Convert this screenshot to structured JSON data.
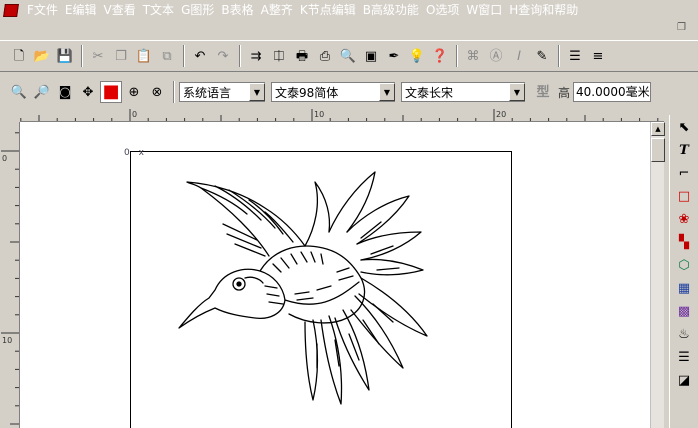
{
  "menu": {
    "items": [
      "F文件",
      "E编辑",
      "V查看",
      "T文本",
      "G图形",
      "B表格",
      "A整齐",
      "K节点编辑",
      "B高级功能",
      "O选项",
      "W窗口",
      "H查询和帮助"
    ]
  },
  "toolbar1": {
    "buttons": [
      {
        "name": "new-file-button",
        "icon": "new-file-icon",
        "glyph": "🗋"
      },
      {
        "name": "open-file-button",
        "icon": "open-folder-icon",
        "glyph": "📂"
      },
      {
        "name": "save-button",
        "icon": "floppy-icon",
        "glyph": "💾"
      },
      {
        "sep": true
      },
      {
        "name": "cut-button",
        "icon": "scissors-icon",
        "glyph": "✂",
        "dis": true
      },
      {
        "name": "copy-button",
        "icon": "copy-icon",
        "glyph": "❐",
        "dis": true
      },
      {
        "name": "paste-button",
        "icon": "paste-icon",
        "glyph": "📋",
        "dis": true
      },
      {
        "name": "paste-special-button",
        "icon": "paste-special-icon",
        "glyph": "⧉",
        "dis": true
      },
      {
        "sep": true
      },
      {
        "name": "undo-button",
        "icon": "undo-icon",
        "glyph": "↶"
      },
      {
        "name": "redo-button",
        "icon": "redo-icon",
        "glyph": "↷",
        "dis": true
      },
      {
        "sep": true
      },
      {
        "name": "import-button",
        "icon": "import-icon",
        "glyph": "⇉"
      },
      {
        "name": "text-frame-button",
        "icon": "text-frame-icon",
        "glyph": "⎅"
      },
      {
        "name": "print-button",
        "icon": "printer-icon",
        "glyph": "🖶"
      },
      {
        "name": "print-preview-button",
        "icon": "preview-icon",
        "glyph": "⎙"
      },
      {
        "name": "zoom-page-button",
        "icon": "page-zoom-icon",
        "glyph": "🔍"
      },
      {
        "name": "frame-button",
        "icon": "frame-icon",
        "glyph": "▣"
      },
      {
        "name": "pen-button",
        "icon": "pen-icon",
        "glyph": "✒"
      },
      {
        "name": "tips-button",
        "icon": "lightbulb-icon",
        "glyph": "💡"
      },
      {
        "name": "help-button",
        "icon": "help-icon",
        "glyph": "❓"
      },
      {
        "sep": true
      },
      {
        "name": "tool-a-button",
        "icon": "tool-a-icon",
        "glyph": "⌘",
        "dis": true
      },
      {
        "name": "tool-b-button",
        "icon": "tool-b-icon",
        "glyph": "Ⓐ",
        "dis": true
      },
      {
        "name": "tool-c-button",
        "icon": "italic-icon",
        "glyph": "𝐼",
        "dis": true
      },
      {
        "name": "tool-d-button",
        "icon": "edit-icon",
        "glyph": "✎"
      },
      {
        "sep": true
      },
      {
        "name": "align-button",
        "icon": "align-icon",
        "glyph": "☰"
      },
      {
        "name": "justify-button",
        "icon": "justify-icon",
        "glyph": "≡"
      }
    ]
  },
  "toolbar2": {
    "buttons": [
      {
        "name": "zoom-in-button",
        "icon": "zoom-in-icon",
        "glyph": "🔍"
      },
      {
        "name": "zoom-out-button",
        "icon": "zoom-out-icon",
        "glyph": "🔎"
      },
      {
        "name": "zoom-fit-button",
        "icon": "zoom-fit-icon",
        "glyph": "◙"
      },
      {
        "name": "move-button",
        "icon": "move-cross-icon",
        "glyph": "✥"
      },
      {
        "name": "fill-color-button",
        "icon": "red-square-icon",
        "glyph": "■",
        "active": true,
        "color": "#e00000"
      },
      {
        "name": "zoom-select-button",
        "icon": "zoom-select-icon",
        "glyph": "⊕"
      },
      {
        "name": "zoom-all-button",
        "icon": "zoom-all-icon",
        "glyph": "⊗"
      }
    ],
    "language": "系统语言",
    "font_cn": "文泰98简体",
    "font_name": "文泰长宋",
    "style_glyph": "型",
    "height_label": "高",
    "height_value": "40.0000毫米"
  },
  "ruler": {
    "top_labels": [
      "0",
      "10",
      "20"
    ],
    "left_labels": [
      "0",
      "10"
    ]
  },
  "origin_label": "0",
  "origin_axis": "x",
  "right_tools": [
    {
      "name": "select-tool",
      "icon": "arrow-cursor-icon",
      "glyph": "⬉"
    },
    {
      "name": "text-tool",
      "icon": "text-t-icon",
      "glyph": "T"
    },
    {
      "name": "crop-tool",
      "icon": "crop-icon",
      "glyph": "⌐"
    },
    {
      "name": "rect-tool",
      "icon": "rectangle-icon",
      "glyph": "□",
      "color": "#d00000"
    },
    {
      "name": "effect-tool",
      "icon": "cherry-icon",
      "glyph": "❀",
      "color": "#c00000"
    },
    {
      "name": "color-tool",
      "icon": "color-icon",
      "glyph": "▚",
      "color": "#c00000"
    },
    {
      "name": "shape-tool",
      "icon": "shapes-icon",
      "glyph": "⬡",
      "color": "#0a7a4a"
    },
    {
      "name": "table-tool",
      "icon": "table-icon",
      "glyph": "▦",
      "color": "#1d3fa0"
    },
    {
      "name": "palette-tool",
      "icon": "palette-icon",
      "glyph": "▩",
      "color": "#7030a0"
    },
    {
      "name": "fill-tool",
      "icon": "fill-bucket-icon",
      "glyph": "♨",
      "color": "#000"
    },
    {
      "name": "list-tool",
      "icon": "list-icon",
      "glyph": "☰"
    },
    {
      "name": "misc-tool",
      "icon": "misc-icon",
      "glyph": "◪"
    }
  ]
}
